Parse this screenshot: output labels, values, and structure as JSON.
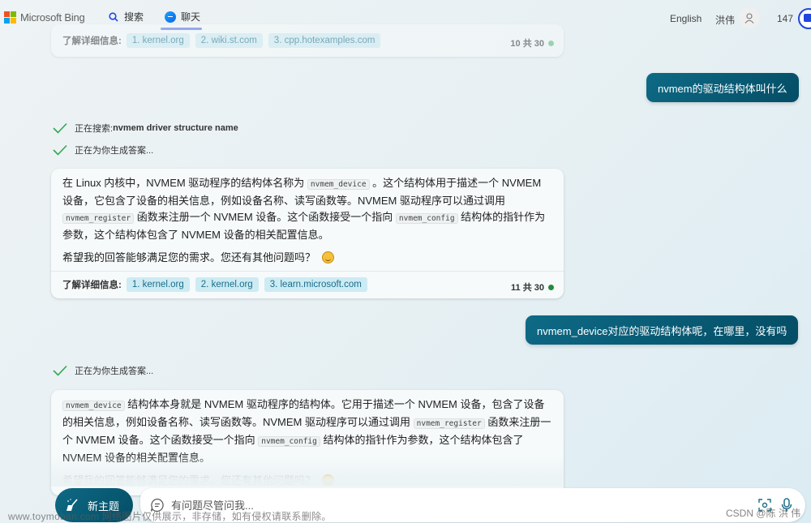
{
  "header": {
    "brand": "Microsoft Bing",
    "tabs": [
      {
        "label": "搜索",
        "icon": "search-icon",
        "active": false
      },
      {
        "label": "聊天",
        "icon": "chat-icon",
        "active": true
      }
    ],
    "language": "English",
    "username": "洪伟",
    "points": "147"
  },
  "previous_card": {
    "learn_more_label": "了解详细信息:",
    "links": [
      "1. kernel.org",
      "2. wiki.st.com",
      "3. cpp.hotexamples.com"
    ],
    "counter": "10 共 30"
  },
  "messages": {
    "user_1": "nvmem的驱动结构体叫什么",
    "status_search_prefix": "正在搜索: ",
    "status_search_query": "nvmem driver structure name",
    "status_generating": "正在为你生成答案...",
    "answer_1": {
      "p1_a": "在 Linux 内核中，NVMEM 驱动程序的结构体名称为 ",
      "code_1": "nvmem_device",
      "p1_b": " 。这个结构体用于描述一个 NVMEM 设备，它包含了设备的相关信息，例如设备名称、读写函数等。NVMEM 驱动程序可以通过调用 ",
      "code_2": "nvmem_register",
      "p1_c": " 函数来注册一个 NVMEM 设备。这个函数接受一个指向 ",
      "code_3": "nvmem_config",
      "p1_d": " 结构体的指针作为参数，这个结构体包含了 NVMEM 设备的相关配置信息。",
      "p2": "希望我的回答能够满足您的需求。您还有其他问题吗？",
      "learn_more_label": "了解详细信息:",
      "links": [
        "1. kernel.org",
        "2. kernel.org",
        "3. learn.microsoft.com"
      ],
      "counter": "11 共 30"
    },
    "user_2": "nvmem_device对应的驱动结构体呢，在哪里，没有吗",
    "status_generating_2": "正在为你生成答案...",
    "answer_2": {
      "code_1": "nvmem_device",
      "p1_a": " 结构体本身就是 NVMEM 驱动程序的结构体。它用于描述一个 NVMEM 设备，包含了设备的相关信息，例如设备名称、读写函数等。NVMEM 驱动程序可以通过调用 ",
      "code_2": "nvmem_register",
      "p1_b": " 函数来注册一个 NVMEM 设备。这个函数接受一个指向 ",
      "code_3": "nvmem_config",
      "p1_c": " 结构体的指针作为参数，这个结构体包含了 NVMEM 设备的相关配置信息。",
      "p2": "希望我的回答能够满足您的需求。您还有其他问题吗？"
    }
  },
  "bottom": {
    "new_topic_label": "新主题",
    "input_placeholder": "有问题尽管问我...",
    "input_value": ""
  },
  "overlay": {
    "watermark": "www.toymoban.com 网络图片仅供展示，非存储，如有侵权请联系删除。",
    "csdn": "CSDN @陈 洪 伟"
  },
  "colors": {
    "accent_blue": "#1f46e0",
    "user_bubble": "#0a5d77",
    "chip_bg": "#cdebf3",
    "status_green": "#218a3f",
    "check_green": "#2fa84f"
  }
}
